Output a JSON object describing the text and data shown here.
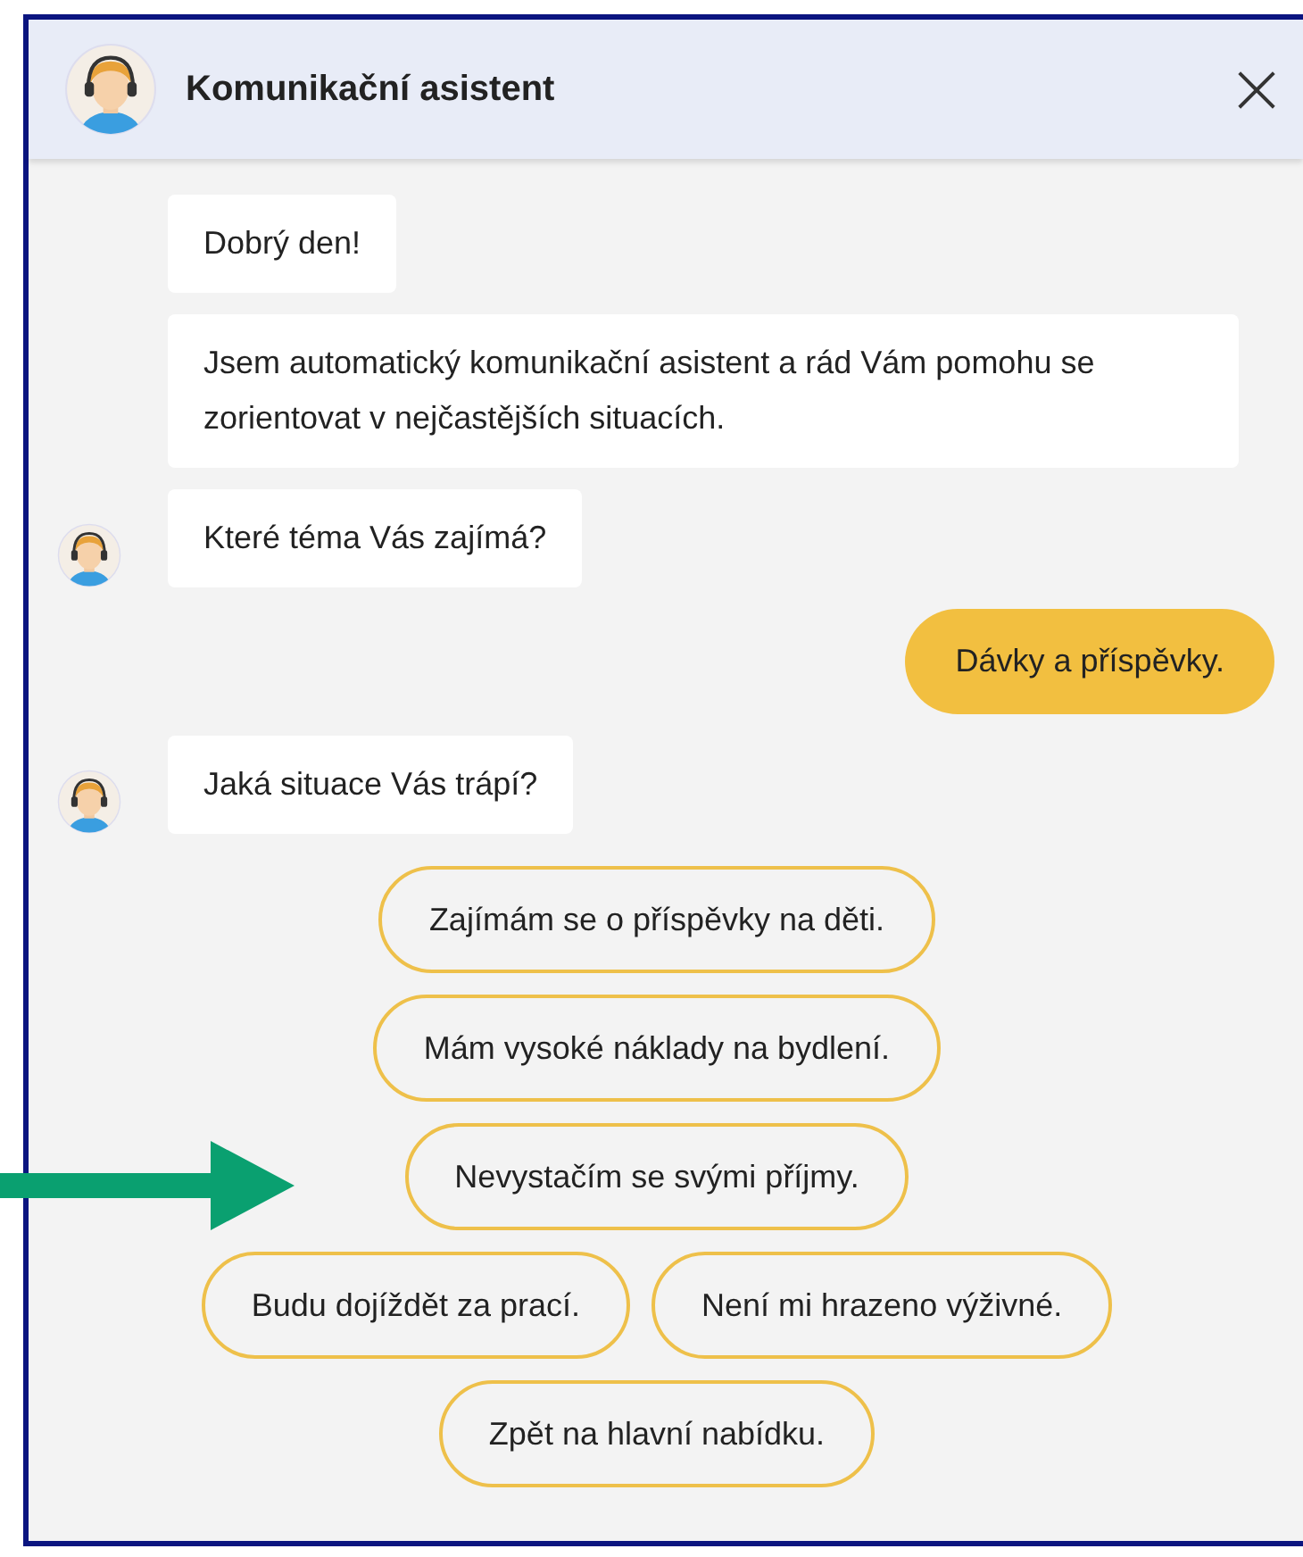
{
  "window": {
    "title": "Komunikační asistent",
    "close": "×"
  },
  "messages": [
    {
      "kind": "bot",
      "text": "Dobrý den!",
      "avatar": false
    },
    {
      "kind": "bot",
      "text": "Jsem automatický komunikační asistent a rád Vám pomohu se zorientovat v nejčastějších situacích.",
      "avatar": false
    },
    {
      "kind": "bot",
      "text": "Které téma Vás zajímá?",
      "avatar": true
    },
    {
      "kind": "user",
      "text": "Dávky a příspěvky."
    },
    {
      "kind": "bot",
      "text": "Jaká situace Vás trápí?",
      "avatar": true
    }
  ],
  "option_rows": [
    [
      "Zajímám se o příspěvky na děti."
    ],
    [
      "Mám vysoké náklady na bydlení."
    ],
    [
      "Nevystačím se svými příjmy."
    ],
    [
      "Budu dojíždět za prací.",
      "Není mi hrazeno výživné."
    ],
    [
      "Zpět na hlavní nabídku."
    ]
  ]
}
